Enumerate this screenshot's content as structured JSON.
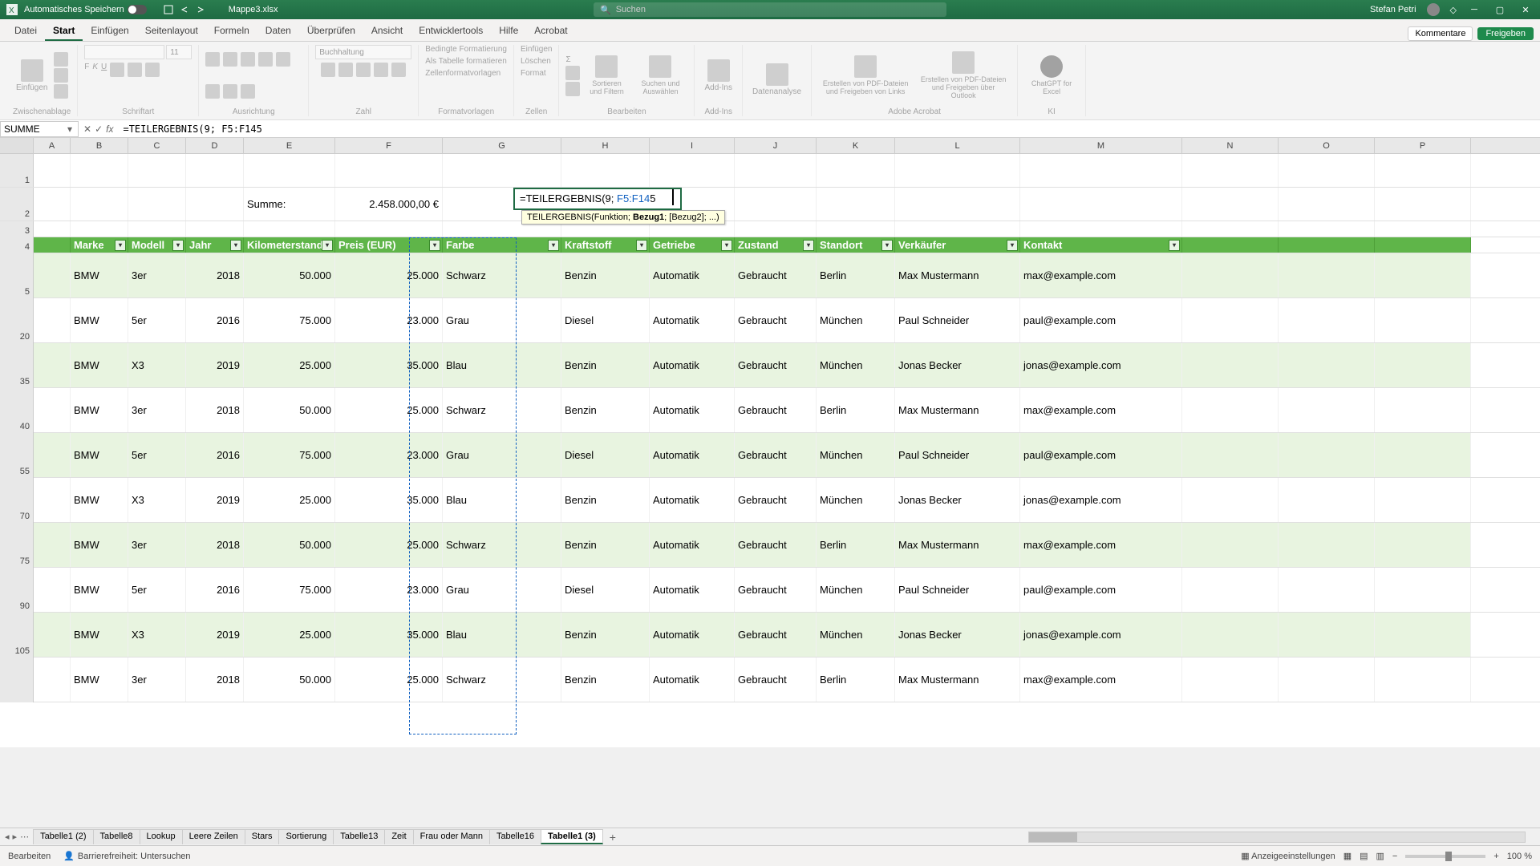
{
  "titlebar": {
    "autosave_label": "Automatisches Speichern",
    "filename": "Mappe3.xlsx",
    "search_placeholder": "Suchen",
    "username": "Stefan Petri"
  },
  "ribbon": {
    "tabs": [
      "Datei",
      "Start",
      "Einfügen",
      "Seitenlayout",
      "Formeln",
      "Daten",
      "Überprüfen",
      "Ansicht",
      "Entwicklertools",
      "Hilfe",
      "Acrobat"
    ],
    "active_tab": 1,
    "comments": "Kommentare",
    "share": "Freigeben",
    "groups": {
      "clipboard": "Zwischenablage",
      "paste": "Einfügen",
      "font": "Schriftart",
      "font_name": "",
      "font_size": "11",
      "alignment": "Ausrichtung",
      "number": "Zahl",
      "number_format": "Buchhaltung",
      "styles": "Formatvorlagen",
      "cond_fmt": "Bedingte Formatierung",
      "as_table": "Als Tabelle formatieren",
      "cell_styles": "Zellenformatvorlagen",
      "cells": "Zellen",
      "insert": "Einfügen",
      "delete": "Löschen",
      "format": "Format",
      "editing": "Bearbeiten",
      "sort_filter": "Sortieren und Filtern",
      "find_select": "Suchen und Auswählen",
      "addins": "Add-Ins",
      "addins_btn": "Add-Ins",
      "analysis": "Datenanalyse",
      "acrobat": "Adobe Acrobat",
      "acrobat1": "Erstellen von PDF-Dateien und Freigeben von Links",
      "acrobat2": "Erstellen von PDF-Dateien und Freigeben über Outlook",
      "ai": "KI",
      "chatgpt": "ChatGPT for Excel"
    }
  },
  "namebox": "SUMME",
  "formula": "=TEILERGEBNIS(9; F5:F145",
  "edit_cell": {
    "prefix": "=TEILERGEBNIS(9; ",
    "ref": "F5:F14",
    "suffix": "5"
  },
  "tooltip": {
    "text": "TEILERGEBNIS(Funktion; ",
    "bold": "Bezug1",
    "rest": "; [Bezug2]; ...)"
  },
  "columns": [
    "A",
    "B",
    "C",
    "D",
    "E",
    "F",
    "G",
    "H",
    "I",
    "J",
    "K",
    "L",
    "M",
    "N",
    "O",
    "P"
  ],
  "summe_label": "Summe:",
  "summe_value": "2.458.000,00 €",
  "table_headers": [
    "Marke",
    "Modell",
    "Jahr",
    "Kilometerstand",
    "Preis (EUR)",
    "Farbe",
    "Kraftstoff",
    "Getriebe",
    "Zustand",
    "Standort",
    "Verkäufer",
    "Kontakt"
  ],
  "row_labels": [
    "1",
    "2",
    "3",
    "4",
    "5",
    "20",
    "35",
    "40",
    "55",
    "70",
    "75",
    "90",
    "105",
    ""
  ],
  "rows": [
    {
      "marke": "BMW",
      "modell": "3er",
      "jahr": "2018",
      "km": "50.000",
      "preis": "25.000",
      "farbe": "Schwarz",
      "kraft": "Benzin",
      "getriebe": "Automatik",
      "zustand": "Gebraucht",
      "standort": "Berlin",
      "verkaeufer": "Max Mustermann",
      "kontakt": "max@example.com"
    },
    {
      "marke": "BMW",
      "modell": "5er",
      "jahr": "2016",
      "km": "75.000",
      "preis": "23.000",
      "farbe": "Grau",
      "kraft": "Diesel",
      "getriebe": "Automatik",
      "zustand": "Gebraucht",
      "standort": "München",
      "verkaeufer": "Paul Schneider",
      "kontakt": "paul@example.com"
    },
    {
      "marke": "BMW",
      "modell": "X3",
      "jahr": "2019",
      "km": "25.000",
      "preis": "35.000",
      "farbe": "Blau",
      "kraft": "Benzin",
      "getriebe": "Automatik",
      "zustand": "Gebraucht",
      "standort": "München",
      "verkaeufer": "Jonas Becker",
      "kontakt": "jonas@example.com"
    },
    {
      "marke": "BMW",
      "modell": "3er",
      "jahr": "2018",
      "km": "50.000",
      "preis": "25.000",
      "farbe": "Schwarz",
      "kraft": "Benzin",
      "getriebe": "Automatik",
      "zustand": "Gebraucht",
      "standort": "Berlin",
      "verkaeufer": "Max Mustermann",
      "kontakt": "max@example.com"
    },
    {
      "marke": "BMW",
      "modell": "5er",
      "jahr": "2016",
      "km": "75.000",
      "preis": "23.000",
      "farbe": "Grau",
      "kraft": "Diesel",
      "getriebe": "Automatik",
      "zustand": "Gebraucht",
      "standort": "München",
      "verkaeufer": "Paul Schneider",
      "kontakt": "paul@example.com"
    },
    {
      "marke": "BMW",
      "modell": "X3",
      "jahr": "2019",
      "km": "25.000",
      "preis": "35.000",
      "farbe": "Blau",
      "kraft": "Benzin",
      "getriebe": "Automatik",
      "zustand": "Gebraucht",
      "standort": "München",
      "verkaeufer": "Jonas Becker",
      "kontakt": "jonas@example.com"
    },
    {
      "marke": "BMW",
      "modell": "3er",
      "jahr": "2018",
      "km": "50.000",
      "preis": "25.000",
      "farbe": "Schwarz",
      "kraft": "Benzin",
      "getriebe": "Automatik",
      "zustand": "Gebraucht",
      "standort": "Berlin",
      "verkaeufer": "Max Mustermann",
      "kontakt": "max@example.com"
    },
    {
      "marke": "BMW",
      "modell": "5er",
      "jahr": "2016",
      "km": "75.000",
      "preis": "23.000",
      "farbe": "Grau",
      "kraft": "Diesel",
      "getriebe": "Automatik",
      "zustand": "Gebraucht",
      "standort": "München",
      "verkaeufer": "Paul Schneider",
      "kontakt": "paul@example.com"
    },
    {
      "marke": "BMW",
      "modell": "X3",
      "jahr": "2019",
      "km": "25.000",
      "preis": "35.000",
      "farbe": "Blau",
      "kraft": "Benzin",
      "getriebe": "Automatik",
      "zustand": "Gebraucht",
      "standort": "München",
      "verkaeufer": "Jonas Becker",
      "kontakt": "jonas@example.com"
    },
    {
      "marke": "BMW",
      "modell": "3er",
      "jahr": "2018",
      "km": "50.000",
      "preis": "25.000",
      "farbe": "Schwarz",
      "kraft": "Benzin",
      "getriebe": "Automatik",
      "zustand": "Gebraucht",
      "standort": "Berlin",
      "verkaeufer": "Max Mustermann",
      "kontakt": "max@example.com"
    }
  ],
  "sheets": [
    "Tabelle1 (2)",
    "Tabelle8",
    "Lookup",
    "Leere Zeilen",
    "Stars",
    "Sortierung",
    "Tabelle13",
    "Zeit",
    "Frau oder Mann",
    "Tabelle16",
    "Tabelle1 (3)"
  ],
  "active_sheet": 10,
  "status": {
    "mode": "Bearbeiten",
    "accessibility": "Barrierefreiheit: Untersuchen",
    "display_settings": "Anzeigeeinstellungen",
    "zoom": "100 %"
  }
}
